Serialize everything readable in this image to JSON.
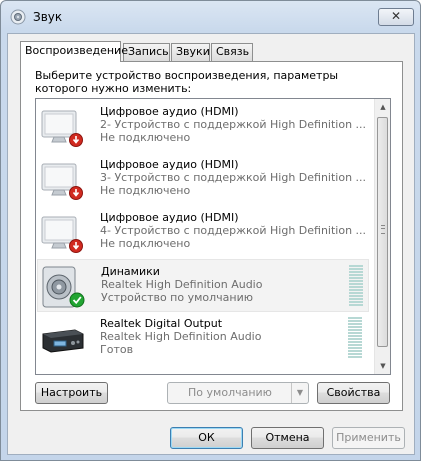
{
  "window": {
    "title": "Звук",
    "app_icon": "speaker-icon",
    "close_symbol": "✕"
  },
  "tabs": [
    {
      "label": "Воспроизведение",
      "active": true
    },
    {
      "label": "Запись",
      "active": false
    },
    {
      "label": "Звуки",
      "active": false
    },
    {
      "label": "Связь",
      "active": false
    }
  ],
  "playback": {
    "instruction": "Выберите устройство воспроизведения, параметры которого нужно изменить:",
    "devices": [
      {
        "name": "Цифровое аудио (HDMI)",
        "description": "2- Устройство с поддержкой High Definition ...",
        "status": "Не подключено",
        "icon": "monitor-icon",
        "state": "disconnected"
      },
      {
        "name": "Цифровое аудио (HDMI)",
        "description": "3- Устройство с поддержкой High Definition ...",
        "status": "Не подключено",
        "icon": "monitor-icon",
        "state": "disconnected"
      },
      {
        "name": "Цифровое аудио (HDMI)",
        "description": "4- Устройство с поддержкой High Definition ...",
        "status": "Не подключено",
        "icon": "monitor-icon",
        "state": "disconnected"
      },
      {
        "name": "Динамики",
        "description": "Realtek High Definition Audio",
        "status": "Устройство по умолчанию",
        "icon": "speaker-icon",
        "state": "default",
        "selected": true
      },
      {
        "name": "Realtek Digital Output",
        "description": "Realtek High Definition Audio",
        "status": "Готов",
        "icon": "digital-output-icon",
        "state": "ready"
      }
    ],
    "buttons": {
      "configure": "Настроить",
      "set_default": "По умолчанию",
      "properties": "Свойства"
    }
  },
  "footer": {
    "ok": "ОК",
    "cancel": "Отмена",
    "apply": "Применить"
  },
  "colors": {
    "title_gradient": "#c4d5ea",
    "level_meter": "#b7d8d4",
    "disconnected_badge": "#c8281e",
    "default_badge": "#1f9b2c"
  }
}
